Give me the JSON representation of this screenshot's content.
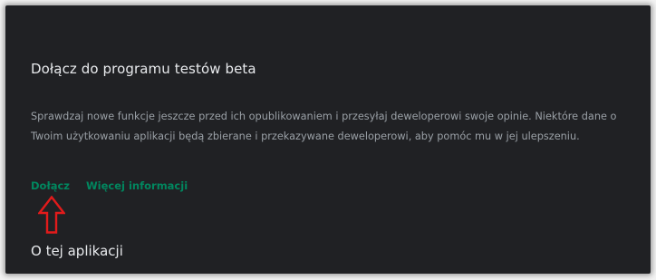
{
  "beta": {
    "title": "Dołącz do programu testów beta",
    "description": "Sprawdzaj nowe funkcje jeszcze przed ich opublikowaniem i przesyłaj deweloperowi swoje opinie. Niektóre dane o Twoim użytkowaniu aplikacji będą zbierane i przekazywane deweloperowi, aby pomóc mu w jej ulepszeniu.",
    "join_label": "Dołącz",
    "more_info_label": "Więcej informacji"
  },
  "about": {
    "title": "O tej aplikacji"
  },
  "colors": {
    "background": "#202124",
    "link": "#01875f",
    "annotation_arrow": "#e21b1b"
  },
  "annotation": {
    "icon": "up-arrow-icon"
  }
}
